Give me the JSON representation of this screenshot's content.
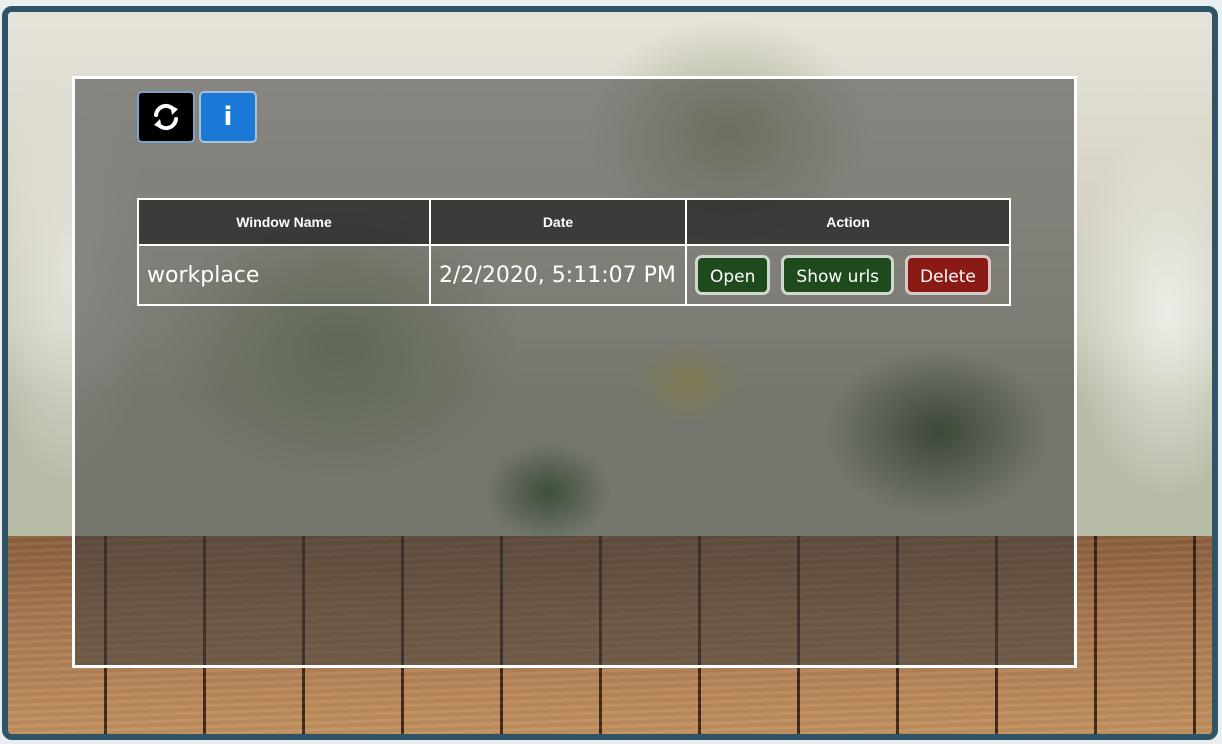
{
  "toolbar": {
    "refresh_icon": "refresh-icon",
    "info_icon": "info-icon",
    "info_glyph": "i"
  },
  "table": {
    "headers": [
      "Window Name",
      "Date",
      "Action"
    ],
    "rows": [
      {
        "name": "workplace",
        "date": "2/2/2020, 5:11:07 PM",
        "actions": {
          "open": "Open",
          "show_urls": "Show urls",
          "delete": "Delete"
        }
      }
    ]
  },
  "colors": {
    "frame_border": "#2f5468",
    "refresh_button": "#000000",
    "info_button": "#1a78d6",
    "action_green": "#1e4a1d",
    "action_red": "#8a1a14"
  }
}
